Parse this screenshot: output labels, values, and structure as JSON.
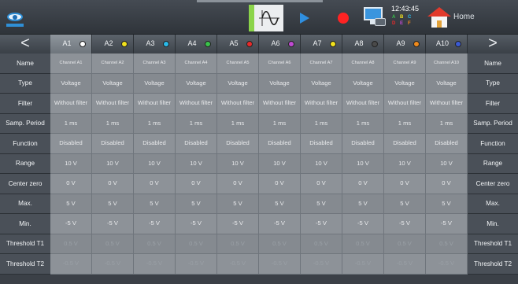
{
  "toolbar": {
    "clock_time": "12:43:45",
    "clock_status": [
      "A",
      "B",
      "C",
      "D",
      "E",
      "F"
    ],
    "home_label": "Home"
  },
  "grid": {
    "prev_glyph": "<",
    "next_glyph": ">",
    "channels": [
      {
        "id": "A1",
        "dot": "#ffffff"
      },
      {
        "id": "A2",
        "dot": "#f2e21c"
      },
      {
        "id": "A3",
        "dot": "#29b9e8"
      },
      {
        "id": "A4",
        "dot": "#39c24a"
      },
      {
        "id": "A5",
        "dot": "#e82a2a"
      },
      {
        "id": "A6",
        "dot": "#c04ad4"
      },
      {
        "id": "A7",
        "dot": "#f2e21c"
      },
      {
        "id": "A8",
        "dot": "#4a4a4a"
      },
      {
        "id": "A9",
        "dot": "#f08a1c"
      },
      {
        "id": "A10",
        "dot": "#3a5ad4"
      }
    ],
    "rows": [
      {
        "label": "Name",
        "values": [
          "Channel A1",
          "Channel A2",
          "Channel A3",
          "Channel A4",
          "Channel A5",
          "Channel A6",
          "Channel A7",
          "Channel A8",
          "Channel A9",
          "Channel A10"
        ]
      },
      {
        "label": "Type",
        "values": [
          "Voltage",
          "Voltage",
          "Voltage",
          "Voltage",
          "Voltage",
          "Voltage",
          "Voltage",
          "Voltage",
          "Voltage",
          "Voltage"
        ]
      },
      {
        "label": "Filter",
        "values": [
          "Without filter",
          "Without filter",
          "Without filter",
          "Without filter",
          "Without filter",
          "Without filter",
          "Without filter",
          "Without filter",
          "Without filter",
          "Without filter"
        ]
      },
      {
        "label": "Samp. Period",
        "values": [
          "1 ms",
          "1 ms",
          "1 ms",
          "1 ms",
          "1 ms",
          "1 ms",
          "1 ms",
          "1 ms",
          "1 ms",
          "1 ms"
        ]
      },
      {
        "label": "Function",
        "values": [
          "Disabled",
          "Disabled",
          "Disabled",
          "Disabled",
          "Disabled",
          "Disabled",
          "Disabled",
          "Disabled",
          "Disabled",
          "Disabled"
        ]
      },
      {
        "label": "Range",
        "values": [
          "10 V",
          "10 V",
          "10 V",
          "10 V",
          "10 V",
          "10 V",
          "10 V",
          "10 V",
          "10 V",
          "10 V"
        ]
      },
      {
        "label": "Center zero",
        "values": [
          "0 V",
          "0 V",
          "0 V",
          "0 V",
          "0 V",
          "0 V",
          "0 V",
          "0 V",
          "0 V",
          "0 V"
        ]
      },
      {
        "label": "Max.",
        "values": [
          "5 V",
          "5 V",
          "5 V",
          "5 V",
          "5 V",
          "5 V",
          "5 V",
          "5 V",
          "5 V",
          "5 V"
        ]
      },
      {
        "label": "Min.",
        "values": [
          "-5 V",
          "-5 V",
          "-5 V",
          "-5 V",
          "-5 V",
          "-5 V",
          "-5 V",
          "-5 V",
          "-5 V",
          "-5 V"
        ]
      },
      {
        "label": "Threshold T1",
        "values": [
          "0.5 V",
          "0.5 V",
          "0.5 V",
          "0.5 V",
          "0.5 V",
          "0.5 V",
          "0.5 V",
          "0.5 V",
          "0.5 V",
          "0.5 V"
        ]
      },
      {
        "label": "Threshold T2",
        "values": [
          "-0.5 V",
          "-0.5 V",
          "-0.5 V",
          "-0.5 V",
          "-0.5 V",
          "-0.5 V",
          "-0.5 V",
          "-0.5 V",
          "-0.5 V",
          "-0.5 V"
        ]
      }
    ]
  },
  "colors": {
    "accent_green": "#8bd44a",
    "record_red": "#ff2323",
    "play_blue": "#2f8fe0"
  }
}
